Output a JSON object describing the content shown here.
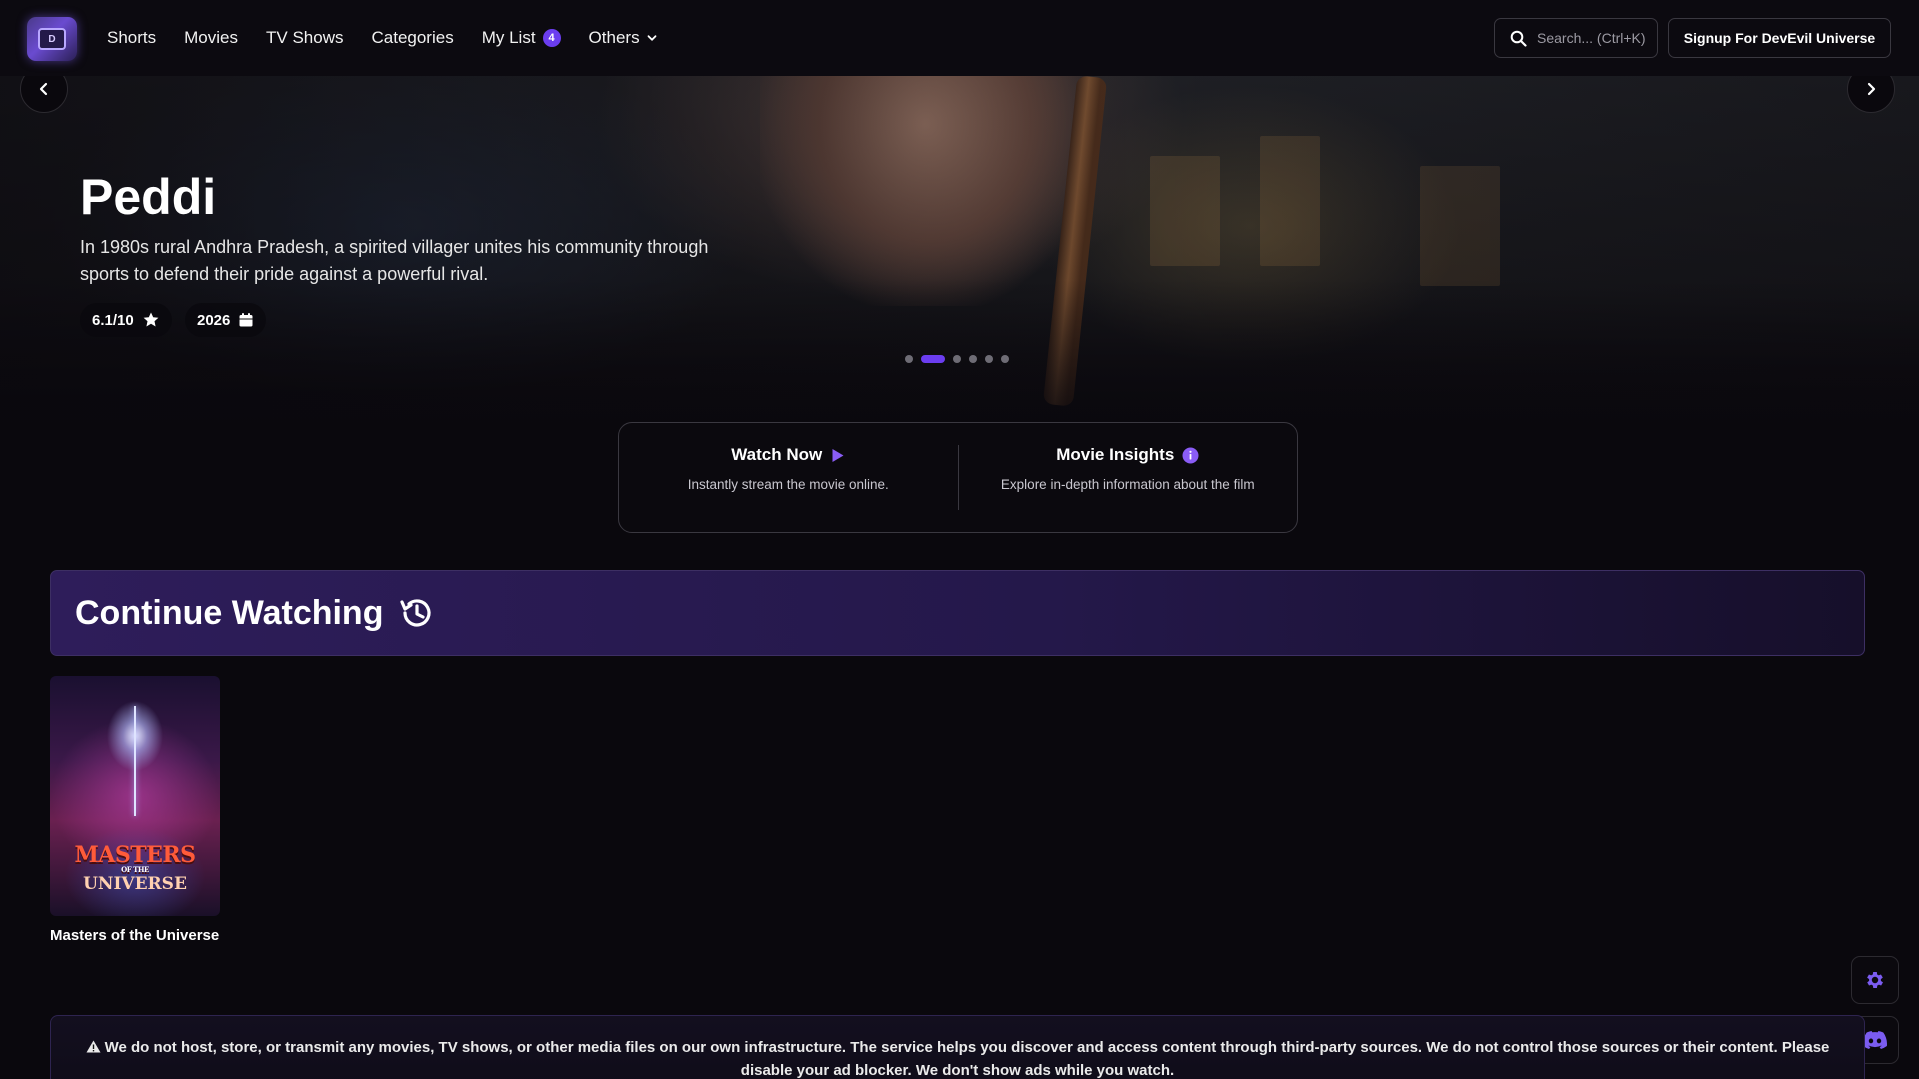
{
  "nav": {
    "logo_text": "D",
    "links": [
      {
        "label": "Shorts"
      },
      {
        "label": "Movies"
      },
      {
        "label": "TV Shows"
      },
      {
        "label": "Categories"
      },
      {
        "label": "My List",
        "badge": "4"
      },
      {
        "label": "Others"
      }
    ],
    "search_placeholder": "Search... (Ctrl+K)",
    "signup_label": "Signup For DevEvil Universe"
  },
  "hero": {
    "title": "Peddi",
    "description": "In 1980s rural Andhra Pradesh, a spirited villager unites his community through sports to defend their pride against a powerful rival.",
    "rating": "6.1/10",
    "year": "2026",
    "slide_count": 6,
    "active_slide": 1
  },
  "actions": {
    "watch": {
      "title": "Watch Now",
      "subtitle": "Instantly stream the movie online."
    },
    "insights": {
      "title": "Movie Insights",
      "subtitle": "Explore in-depth information about the film"
    }
  },
  "continue_watching": {
    "title": "Continue Watching",
    "items": [
      {
        "title": "Masters of the Universe",
        "poster_line1": "MASTERS",
        "poster_line2": "OF THE",
        "poster_line3": "UNIVERSE"
      }
    ]
  },
  "disclaimer": {
    "text": "We do not host, store, or transmit any movies, TV shows, or other media files on our own infrastructure. The service helps you discover and access content through third-party sources. We do not control those sources or their content. Please disable your ad blocker. We don't show ads while you watch."
  },
  "colors": {
    "accent": "#6b3df0",
    "background": "#0a080d",
    "banner": "#2e1d5a"
  },
  "icons": [
    "search-icon",
    "chevron-down-icon",
    "chevron-left-icon",
    "chevron-right-icon",
    "star-icon",
    "calendar-icon",
    "play-icon",
    "info-icon",
    "history-icon",
    "gear-icon",
    "discord-icon",
    "warning-icon"
  ]
}
